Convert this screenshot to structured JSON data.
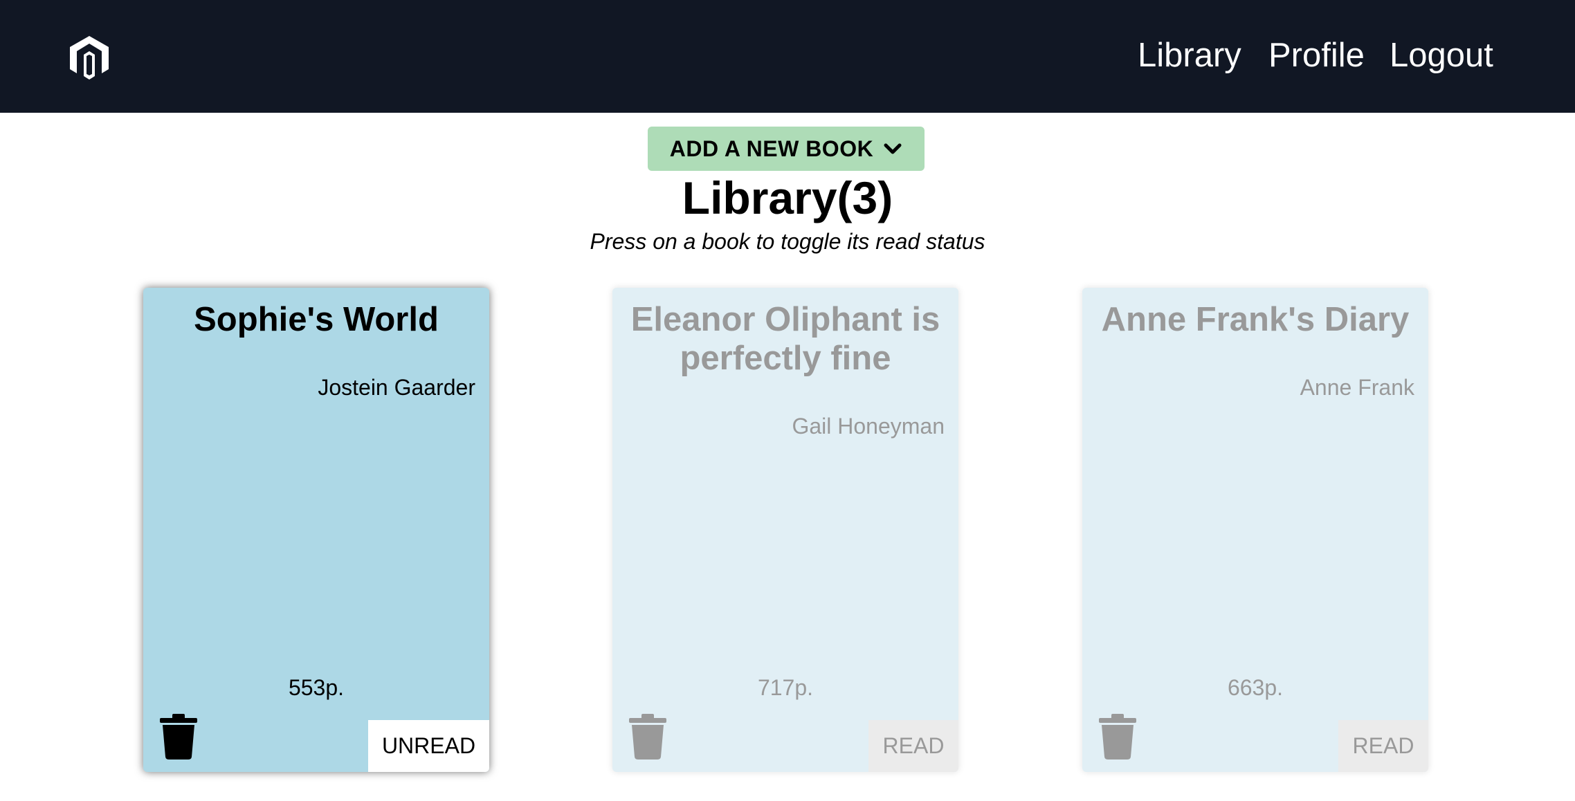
{
  "nav": {
    "logo_icon": "hexagon-logo-icon",
    "links": [
      "Library",
      "Profile",
      "Logout"
    ]
  },
  "add_button": {
    "label": "ADD A NEW BOOK",
    "icon": "chevron-down-icon",
    "color": "#aedcb7"
  },
  "page": {
    "title": "Library(3)",
    "subtitle": "Press on a book to toggle its read status"
  },
  "books": [
    {
      "title": "Sophie's World",
      "author": "Jostein Gaarder",
      "pages": "553p.",
      "status": "UNREAD",
      "delete_icon": "trash-icon"
    },
    {
      "title": "Eleanor Oliphant is perfectly fine",
      "author": "Gail Honeyman",
      "pages": "717p.",
      "status": "READ",
      "delete_icon": "trash-icon"
    },
    {
      "title": "Anne Frank's Diary",
      "author": "Anne Frank",
      "pages": "663p.",
      "status": "READ",
      "delete_icon": "trash-icon"
    }
  ],
  "colors": {
    "navbar": "#111724",
    "card_unread": "#add8e6",
    "card_read": "#e1eff5",
    "muted_text": "#999999"
  }
}
